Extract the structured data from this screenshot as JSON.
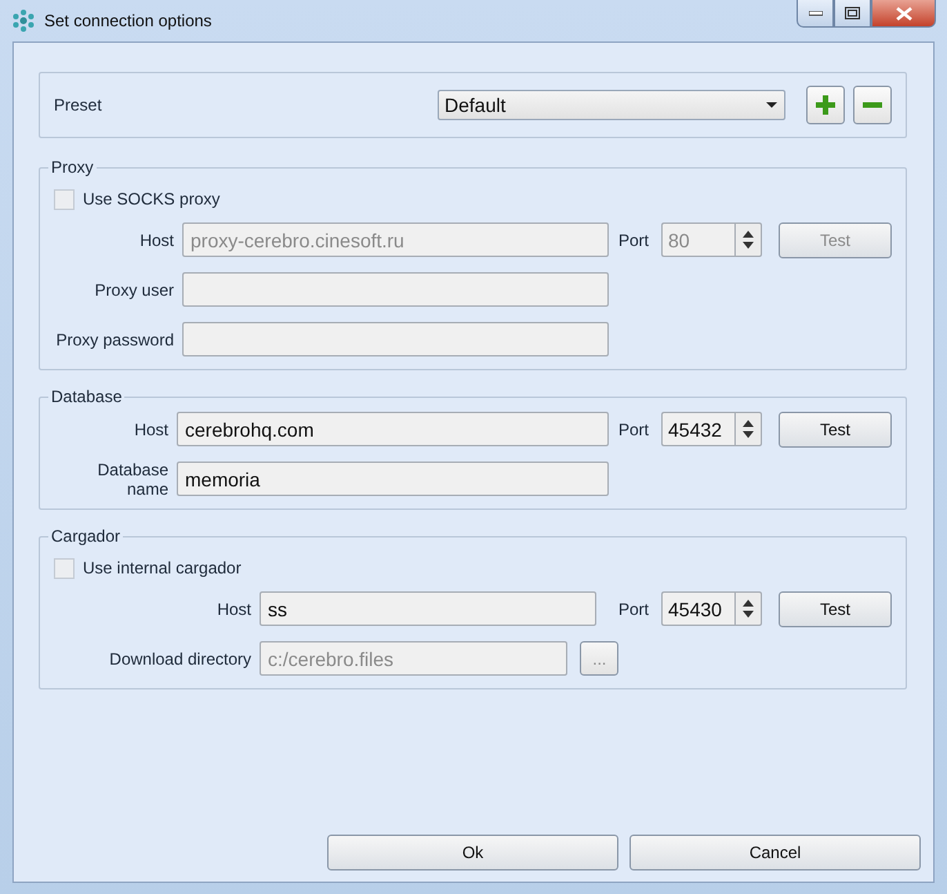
{
  "window": {
    "title": "Set connection options"
  },
  "preset": {
    "label": "Preset",
    "value": "Default"
  },
  "sections": [
    {
      "title": "Proxy",
      "checkbox": {
        "label": "Use SOCKS proxy",
        "checked": false
      },
      "rows": [
        {
          "label": "Host",
          "value": "proxy-cerebro.cinesoft.ru",
          "disabled": true,
          "port": {
            "label": "Port",
            "value": "80",
            "disabled": true
          },
          "test": {
            "label": "Test",
            "disabled": true
          }
        },
        {
          "label": "Proxy user"
        },
        {
          "label": "Proxy password"
        }
      ]
    },
    {
      "title": "Database",
      "rows": [
        {
          "label": "Host",
          "value": "cerebrohq.com",
          "disabled": false,
          "port": {
            "label": "Port",
            "value": "45432",
            "disabled": false
          },
          "test": {
            "label": "Test",
            "disabled": false
          }
        },
        {
          "label": "Database name",
          "value": "memoria",
          "disabled": false
        }
      ]
    },
    {
      "title": "Cargador",
      "checkbox": {
        "label": "Use internal cargador",
        "checked": false
      },
      "rows": [
        {
          "label": "Host",
          "value": "ss",
          "disabled": false,
          "port": {
            "label": "Port",
            "value": "45430",
            "disabled": false
          },
          "test": {
            "label": "Test",
            "disabled": false
          }
        },
        {
          "label": "Download directory",
          "value": "c:/cerebro.files",
          "disabled": true,
          "browse": {
            "label": "...",
            "disabled": true
          }
        }
      ]
    }
  ],
  "buttons": [
    {
      "label": "Ok"
    },
    {
      "label": "Cancel"
    }
  ]
}
